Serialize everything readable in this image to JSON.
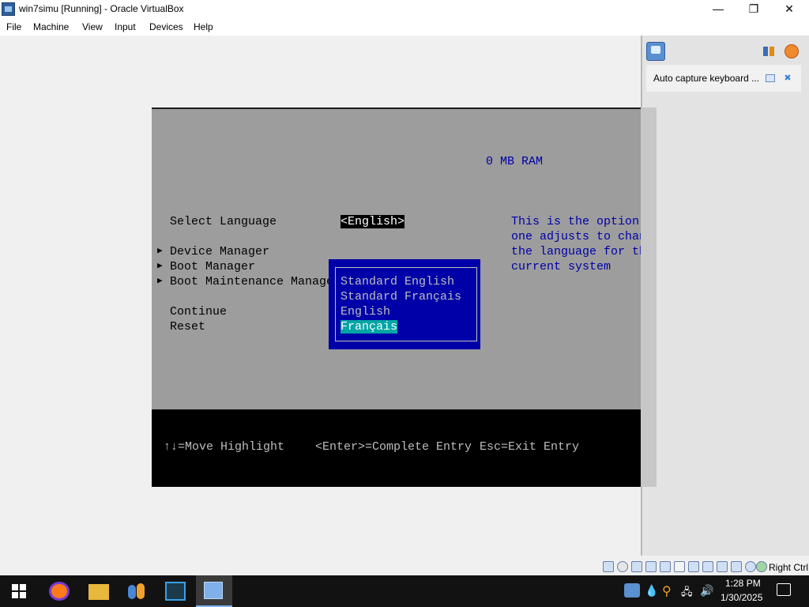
{
  "window": {
    "title": "win7simu [Running] - Oracle VirtualBox",
    "minimize": "—",
    "maximize": "❐",
    "close": "✕"
  },
  "menu": [
    "File",
    "Machine",
    "View",
    "Input",
    "Devices",
    "Help"
  ],
  "bios": {
    "ram": "0 MB RAM",
    "select_language_label": "Select Language",
    "select_language_value": "<English>",
    "menu_items": [
      "Device Manager",
      "Boot Manager",
      "Boot Maintenance Manager"
    ],
    "continue": "Continue",
    "reset": "Reset",
    "help_lines": [
      "This is the option",
      "one adjusts to change",
      "the language for the",
      "current system"
    ],
    "language_options": [
      "Standard English",
      "Standard Français",
      "English",
      "Français"
    ],
    "selected_option": "Français",
    "footer": {
      "move": "↑↓=Move Highlight",
      "enter": "<Enter>=Complete Entry",
      "esc": "Esc=Exit Entry"
    }
  },
  "side_panel": {
    "notification": "Auto capture keyboard ..."
  },
  "status": {
    "host_key": "Right Ctrl"
  },
  "taskbar": {
    "time": "1:28 PM",
    "date": "1/30/2025"
  },
  "colors": {
    "guest_bg": "#9d9d9d",
    "bios_text": "#000000",
    "help_text": "#0000a8",
    "popup_bg": "#0000a8",
    "popup_text": "#bdbdbd",
    "popup_selected": "#00a5a5",
    "highlight_value_bg": "#000000"
  }
}
